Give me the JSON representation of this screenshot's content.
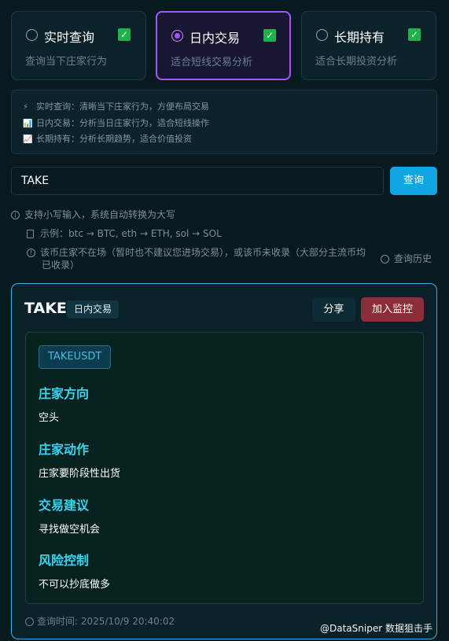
{
  "modes": [
    {
      "title": "实时查询",
      "desc": "查询当下庄家行为",
      "selected": false,
      "checked": true
    },
    {
      "title": "日内交易",
      "desc": "适合短线交易分析",
      "selected": true,
      "checked": true
    },
    {
      "title": "长期持有",
      "desc": "适合长期投资分析",
      "selected": false,
      "checked": true
    }
  ],
  "info": {
    "lines": [
      {
        "icon": "lightning-icon",
        "glyph": "⚡",
        "text": "实时查询：清晰当下庄家行为，方便布局交易"
      },
      {
        "icon": "bar-chart-icon",
        "glyph": "📊",
        "text": "日内交易：分析当日庄家行为，适合短线操作"
      },
      {
        "icon": "trend-chart-icon",
        "glyph": "📈",
        "text": "长期持有：分析长期趋势，适合价值投资"
      }
    ]
  },
  "search": {
    "value": "TAKE",
    "button_label": "查询"
  },
  "hints": {
    "lowercase": "支持小写输入，系统自动转换为大写",
    "example": "示例：btc → BTC, eth → ETH, sol → SOL",
    "not_found_line1": "该币庄家不在场（暂时也不建议您进场交易），或该币未收录（大部分主流币均",
    "not_found_line2": "已收录）",
    "history": "查询历史"
  },
  "result": {
    "symbol": "TAKE",
    "mode_tag": "日内交易",
    "share_label": "分享",
    "monitor_label": "加入监控",
    "pair": "TAKEUSDT",
    "sections": [
      {
        "title": "庄家方向",
        "text": "空头"
      },
      {
        "title": "庄家动作",
        "text": "庄家要阶段性出货"
      },
      {
        "title": "交易建议",
        "text": "寻找做空机会"
      },
      {
        "title": "风险控制",
        "text": "不可以抄底做多"
      }
    ],
    "query_time": "查询时间: 2025/10/9 20:40:02"
  },
  "watermark": "@DataSniper 数据狙击手",
  "colors": {
    "accent": "#a855f7",
    "primary": "#0ea5e0",
    "danger": "#8c2d37",
    "heading": "#39d4ef"
  }
}
